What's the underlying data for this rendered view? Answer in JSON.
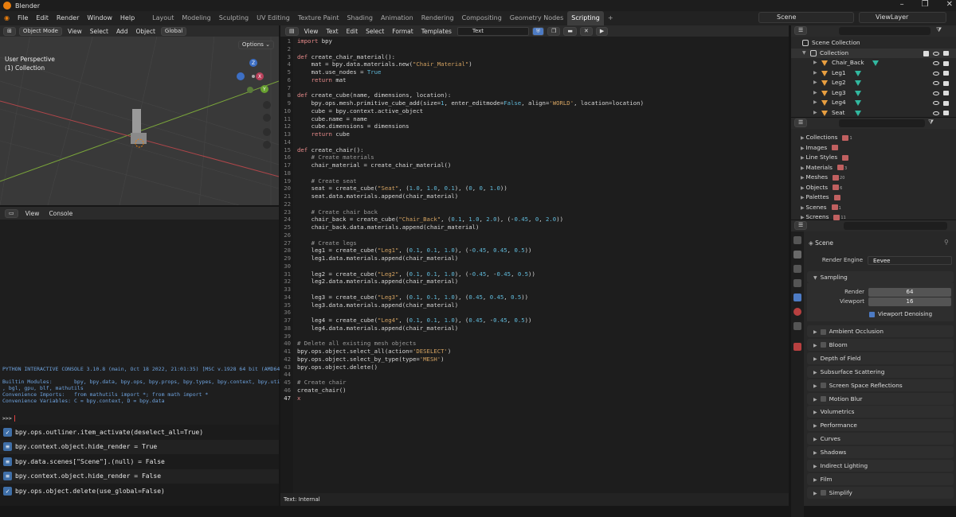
{
  "window": {
    "title": "Blender",
    "controls": [
      "–",
      "❐",
      "✕"
    ]
  },
  "menu": [
    "File",
    "Edit",
    "Render",
    "Window",
    "Help"
  ],
  "workspaces": [
    "Layout",
    "Modeling",
    "Sculpting",
    "UV Editing",
    "Texture Paint",
    "Shading",
    "Animation",
    "Rendering",
    "Compositing",
    "Geometry Nodes",
    "Scripting",
    "+"
  ],
  "active_workspace": "Scripting",
  "scene": "Scene",
  "view_layer": "ViewLayer",
  "viewport": {
    "mode": "Object Mode",
    "menus": [
      "View",
      "Select",
      "Add",
      "Object"
    ],
    "orientation": "Global",
    "options": "Options ⌄",
    "perspective": "User Perspective",
    "collection": "(1) Collection",
    "gizmo_axes": [
      "X",
      "Y",
      "Z"
    ]
  },
  "console": {
    "menus": [
      "View",
      "Console"
    ],
    "output": "PYTHON INTERACTIVE CONSOLE 3.10.8 (main, Oct 18 2022, 21:01:35) [MSC v.1928 64 bit (AMD64)]\n\nBuiltin Modules:       bpy, bpy.data, bpy.ops, bpy.props, bpy.types, bpy.context, bpy.utils\n, bgl, gpu, blf, mathutils\nConvenience Imports:   from mathutils import *; from math import *\nConvenience Variables: C = bpy.context, D = bpy.data",
    "prompt": ">>>"
  },
  "info_log": [
    {
      "icon": "check-icon",
      "text": "bpy.ops.outliner.item_activate(deselect_all=True)"
    },
    {
      "icon": "slider-icon",
      "text": "bpy.context.object.hide_render = True"
    },
    {
      "icon": "slider-icon",
      "text": "bpy.data.scenes[\"Scene\"].(null) = False"
    },
    {
      "icon": "slider-icon",
      "text": "bpy.context.object.hide_render = False"
    },
    {
      "icon": "check-icon",
      "text": "bpy.ops.object.delete(use_global=False)"
    }
  ],
  "text_editor": {
    "menus": [
      "View",
      "Text",
      "Edit",
      "Select",
      "Format",
      "Templates"
    ],
    "text_name": "Text",
    "status": "Text: Internal",
    "current_line": 47,
    "lines": [
      [
        [
          "kw",
          "import"
        ],
        [
          "tx",
          " bpy"
        ]
      ],
      [],
      [
        [
          "kw",
          "def"
        ],
        [
          "tx",
          " create_chair_material():"
        ]
      ],
      [
        [
          "tx",
          "    mat = bpy.data.materials.new("
        ],
        [
          "st",
          "\"Chair_Material\""
        ],
        [
          "tx",
          ")"
        ]
      ],
      [
        [
          "tx",
          "    mat.use_nodes = "
        ],
        [
          "nu",
          "True"
        ]
      ],
      [
        [
          "kw",
          "    return"
        ],
        [
          "tx",
          " mat"
        ]
      ],
      [],
      [
        [
          "kw",
          "def"
        ],
        [
          "tx",
          " create_cube(name, dimensions, location):"
        ]
      ],
      [
        [
          "tx",
          "    bpy.ops.mesh.primitive_cube_add(size="
        ],
        [
          "nu",
          "1"
        ],
        [
          "tx",
          ", enter_editmode="
        ],
        [
          "nu",
          "False"
        ],
        [
          "tx",
          ", align="
        ],
        [
          "st",
          "'WORLD'"
        ],
        [
          "tx",
          ", location=location)"
        ]
      ],
      [
        [
          "tx",
          "    cube = bpy.context.active_object"
        ]
      ],
      [
        [
          "tx",
          "    cube.name = name"
        ]
      ],
      [
        [
          "tx",
          "    cube.dimensions = dimensions"
        ]
      ],
      [
        [
          "kw",
          "    return"
        ],
        [
          "tx",
          " cube"
        ]
      ],
      [],
      [
        [
          "kw",
          "def"
        ],
        [
          "tx",
          " create_chair():"
        ]
      ],
      [
        [
          "cm",
          "    # Create materials"
        ]
      ],
      [
        [
          "tx",
          "    chair_material = create_chair_material()"
        ]
      ],
      [],
      [
        [
          "cm",
          "    # Create seat"
        ]
      ],
      [
        [
          "tx",
          "    seat = create_cube("
        ],
        [
          "st",
          "\"Seat\""
        ],
        [
          "tx",
          ", ("
        ],
        [
          "nu",
          "1.0"
        ],
        [
          "tx",
          ", "
        ],
        [
          "nu",
          "1.0"
        ],
        [
          "tx",
          ", "
        ],
        [
          "nu",
          "0.1"
        ],
        [
          "tx",
          "), ("
        ],
        [
          "nu",
          "0"
        ],
        [
          "tx",
          ", "
        ],
        [
          "nu",
          "0"
        ],
        [
          "tx",
          ", "
        ],
        [
          "nu",
          "1.0"
        ],
        [
          "tx",
          "))"
        ]
      ],
      [
        [
          "tx",
          "    seat.data.materials.append(chair_material)"
        ]
      ],
      [],
      [
        [
          "cm",
          "    # Create chair back"
        ]
      ],
      [
        [
          "tx",
          "    chair_back = create_cube("
        ],
        [
          "st",
          "\"Chair_Back\""
        ],
        [
          "tx",
          ", ("
        ],
        [
          "nu",
          "0.1"
        ],
        [
          "tx",
          ", "
        ],
        [
          "nu",
          "1.0"
        ],
        [
          "tx",
          ", "
        ],
        [
          "nu",
          "2.0"
        ],
        [
          "tx",
          "), (-"
        ],
        [
          "nu",
          "0.45"
        ],
        [
          "tx",
          ", "
        ],
        [
          "nu",
          "0"
        ],
        [
          "tx",
          ", "
        ],
        [
          "nu",
          "2.0"
        ],
        [
          "tx",
          "))"
        ]
      ],
      [
        [
          "tx",
          "    chair_back.data.materials.append(chair_material)"
        ]
      ],
      [],
      [
        [
          "cm",
          "    # Create legs"
        ]
      ],
      [
        [
          "tx",
          "    leg1 = create_cube("
        ],
        [
          "st",
          "\"Leg1\""
        ],
        [
          "tx",
          ", ("
        ],
        [
          "nu",
          "0.1"
        ],
        [
          "tx",
          ", "
        ],
        [
          "nu",
          "0.1"
        ],
        [
          "tx",
          ", "
        ],
        [
          "nu",
          "1.0"
        ],
        [
          "tx",
          "), (-"
        ],
        [
          "nu",
          "0.45"
        ],
        [
          "tx",
          ", "
        ],
        [
          "nu",
          "0.45"
        ],
        [
          "tx",
          ", "
        ],
        [
          "nu",
          "0.5"
        ],
        [
          "tx",
          "))"
        ]
      ],
      [
        [
          "tx",
          "    leg1.data.materials.append(chair_material)"
        ]
      ],
      [],
      [
        [
          "tx",
          "    leg2 = create_cube("
        ],
        [
          "st",
          "\"Leg2\""
        ],
        [
          "tx",
          ", ("
        ],
        [
          "nu",
          "0.1"
        ],
        [
          "tx",
          ", "
        ],
        [
          "nu",
          "0.1"
        ],
        [
          "tx",
          ", "
        ],
        [
          "nu",
          "1.0"
        ],
        [
          "tx",
          "), (-"
        ],
        [
          "nu",
          "0.45"
        ],
        [
          "tx",
          ", -"
        ],
        [
          "nu",
          "0.45"
        ],
        [
          "tx",
          ", "
        ],
        [
          "nu",
          "0.5"
        ],
        [
          "tx",
          "))"
        ]
      ],
      [
        [
          "tx",
          "    leg2.data.materials.append(chair_material)"
        ]
      ],
      [],
      [
        [
          "tx",
          "    leg3 = create_cube("
        ],
        [
          "st",
          "\"Leg3\""
        ],
        [
          "tx",
          ", ("
        ],
        [
          "nu",
          "0.1"
        ],
        [
          "tx",
          ", "
        ],
        [
          "nu",
          "0.1"
        ],
        [
          "tx",
          ", "
        ],
        [
          "nu",
          "1.0"
        ],
        [
          "tx",
          "), ("
        ],
        [
          "nu",
          "0.45"
        ],
        [
          "tx",
          ", "
        ],
        [
          "nu",
          "0.45"
        ],
        [
          "tx",
          ", "
        ],
        [
          "nu",
          "0.5"
        ],
        [
          "tx",
          "))"
        ]
      ],
      [
        [
          "tx",
          "    leg3.data.materials.append(chair_material)"
        ]
      ],
      [],
      [
        [
          "tx",
          "    leg4 = create_cube("
        ],
        [
          "st",
          "\"Leg4\""
        ],
        [
          "tx",
          ", ("
        ],
        [
          "nu",
          "0.1"
        ],
        [
          "tx",
          ", "
        ],
        [
          "nu",
          "0.1"
        ],
        [
          "tx",
          ", "
        ],
        [
          "nu",
          "1.0"
        ],
        [
          "tx",
          "), ("
        ],
        [
          "nu",
          "0.45"
        ],
        [
          "tx",
          ", -"
        ],
        [
          "nu",
          "0.45"
        ],
        [
          "tx",
          ", "
        ],
        [
          "nu",
          "0.5"
        ],
        [
          "tx",
          "))"
        ]
      ],
      [
        [
          "tx",
          "    leg4.data.materials.append(chair_material)"
        ]
      ],
      [],
      [
        [
          "cm",
          "# Delete all existing mesh objects"
        ]
      ],
      [
        [
          "tx",
          "bpy.ops.object.select_all(action="
        ],
        [
          "st",
          "'DESELECT'"
        ],
        [
          "tx",
          ")"
        ]
      ],
      [
        [
          "tx",
          "bpy.ops.object.select_by_type(type="
        ],
        [
          "st",
          "'MESH'"
        ],
        [
          "tx",
          ")"
        ]
      ],
      [
        [
          "tx",
          "bpy.ops.object.delete()"
        ]
      ],
      [],
      [
        [
          "cm",
          "# Create chair"
        ]
      ],
      [
        [
          "tx",
          "create_chair()"
        ]
      ],
      [
        [
          "kw",
          "x"
        ]
      ]
    ]
  },
  "outliner": {
    "root": "Scene Collection",
    "collection": "Collection",
    "objects": [
      "Chair_Back",
      "Leg1",
      "Leg2",
      "Leg3",
      "Leg4",
      "Seat"
    ]
  },
  "data_api": {
    "items": [
      {
        "label": "Collections",
        "count": "1"
      },
      {
        "label": "Images",
        "count": ""
      },
      {
        "label": "Line Styles",
        "count": ""
      },
      {
        "label": "Materials",
        "count": "3"
      },
      {
        "label": "Meshes",
        "count": "20"
      },
      {
        "label": "Objects",
        "count": "6"
      },
      {
        "label": "Palettes",
        "count": ""
      },
      {
        "label": "Scenes",
        "count": "1"
      },
      {
        "label": "Screens",
        "count": "11"
      }
    ]
  },
  "properties": {
    "context": "Scene",
    "render_engine_label": "Render Engine",
    "render_engine": "Eevee",
    "sampling": {
      "title": "Sampling",
      "render_label": "Render",
      "render": "64",
      "viewport_label": "Viewport",
      "viewport": "16",
      "denoise": "Viewport Denoising"
    },
    "sections": [
      {
        "label": "Ambient Occlusion",
        "checkbox": true
      },
      {
        "label": "Bloom",
        "checkbox": true
      },
      {
        "label": "Depth of Field",
        "checkbox": false
      },
      {
        "label": "Subsurface Scattering",
        "checkbox": false
      },
      {
        "label": "Screen Space Reflections",
        "checkbox": true
      },
      {
        "label": "Motion Blur",
        "checkbox": true
      },
      {
        "label": "Volumetrics",
        "checkbox": false
      },
      {
        "label": "Performance",
        "checkbox": false
      },
      {
        "label": "Curves",
        "checkbox": false
      },
      {
        "label": "Shadows",
        "checkbox": false
      },
      {
        "label": "Indirect Lighting",
        "checkbox": false
      },
      {
        "label": "Film",
        "checkbox": false
      },
      {
        "label": "Simplify",
        "checkbox": true
      }
    ]
  },
  "colors": {
    "accent": "#4d7bc4",
    "orange": "#e87d0d",
    "mesh": "#32b8a0"
  }
}
